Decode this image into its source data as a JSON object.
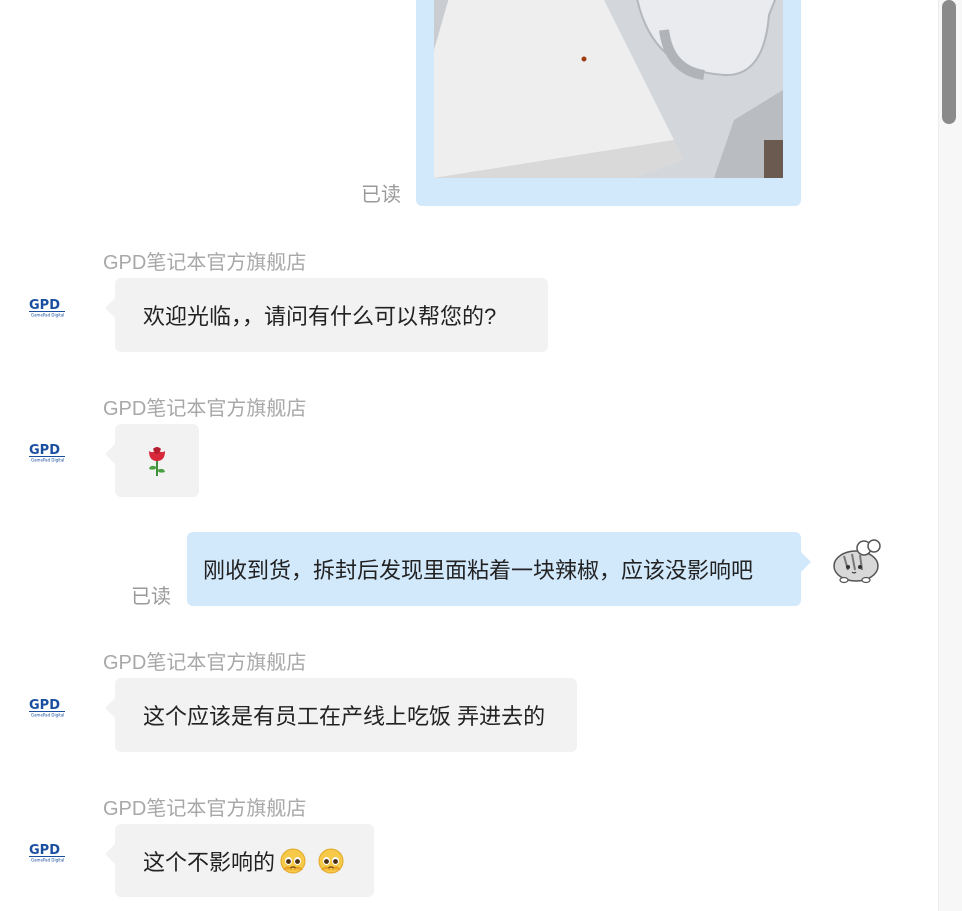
{
  "messages": [
    {
      "side": "out",
      "type": "image",
      "read_label": "已读",
      "image_desc": "photo-packaging"
    },
    {
      "side": "in",
      "sender": "GPD笔记本官方旗舰店",
      "avatar": "gpd-logo",
      "text": "欢迎光临，，请问有什么可以帮您的?"
    },
    {
      "side": "in",
      "sender": "GPD笔记本官方旗舰店",
      "avatar": "gpd-logo",
      "type": "sticker",
      "sticker_icon": "rose-emoji"
    },
    {
      "side": "out",
      "read_label": "已读",
      "avatar": "cat-avatar",
      "text": "刚收到货，拆封后发现里面粘着一块辣椒，应该没影响吧"
    },
    {
      "side": "in",
      "sender": "GPD笔记本官方旗舰店",
      "avatar": "gpd-logo",
      "text": "这个应该是有员工在产线上吃饭 弄进去的"
    },
    {
      "side": "in",
      "sender": "GPD笔记本官方旗舰店",
      "avatar": "gpd-logo",
      "text": "这个不影响的",
      "trailing_icons": [
        "pleading-face-emoji",
        "pleading-face-emoji"
      ]
    }
  ],
  "colors": {
    "incoming_bubble": "#f2f2f2",
    "outgoing_bubble": "#d2e8fb",
    "meta_text": "#a8a8a8",
    "logo_blue": "#1a4fa0"
  }
}
